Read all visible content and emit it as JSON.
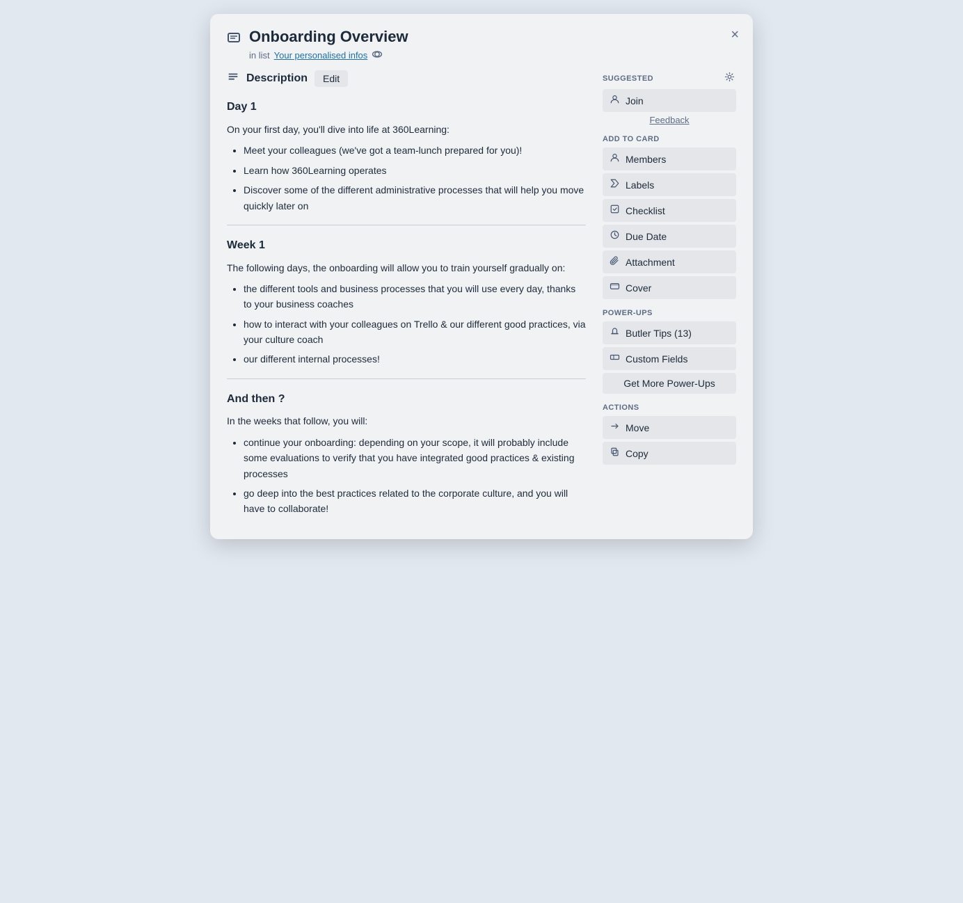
{
  "modal": {
    "title": "Onboarding Overview",
    "subtitle_prefix": "in list",
    "list_name": "Your personalised infos",
    "close_label": "×"
  },
  "description": {
    "heading": "Description",
    "edit_label": "Edit"
  },
  "content": {
    "day1_heading": "Day 1",
    "day1_intro": "On your first day, you'll dive into life at 360Learning:",
    "day1_bullets": [
      "Meet your colleagues (we've got a team-lunch prepared for you)!",
      "Learn how 360Learning operates",
      "Discover some of the different administrative processes that will help you move quickly later on"
    ],
    "week1_heading": "Week 1",
    "week1_intro": "The following days, the onboarding will allow you to train yourself gradually on:",
    "week1_bullets": [
      "the different tools and business processes that you will use every day, thanks to your business coaches",
      "how to interact with your colleagues on Trello & our different good practices, via your culture coach",
      "our different internal processes!"
    ],
    "andthen_heading": "And then ?",
    "andthen_intro": "In the weeks that follow, you will:",
    "andthen_bullets": [
      "continue your onboarding: depending on your scope, it will probably include some evaluations to verify that you have integrated good practices & existing processes",
      "go deep into the best practices related to the corporate culture, and you will have to collaborate!"
    ]
  },
  "sidebar": {
    "suggested_label": "SUGGESTED",
    "join_label": "Join",
    "feedback_label": "Feedback",
    "add_to_card_label": "ADD TO CARD",
    "members_label": "Members",
    "labels_label": "Labels",
    "checklist_label": "Checklist",
    "due_date_label": "Due Date",
    "attachment_label": "Attachment",
    "cover_label": "Cover",
    "power_ups_label": "POWER-UPS",
    "butler_tips_label": "Butler Tips (13)",
    "custom_fields_label": "Custom Fields",
    "get_more_label": "Get More Power-Ups",
    "actions_label": "ACTIONS",
    "move_label": "Move",
    "copy_label": "Copy"
  }
}
